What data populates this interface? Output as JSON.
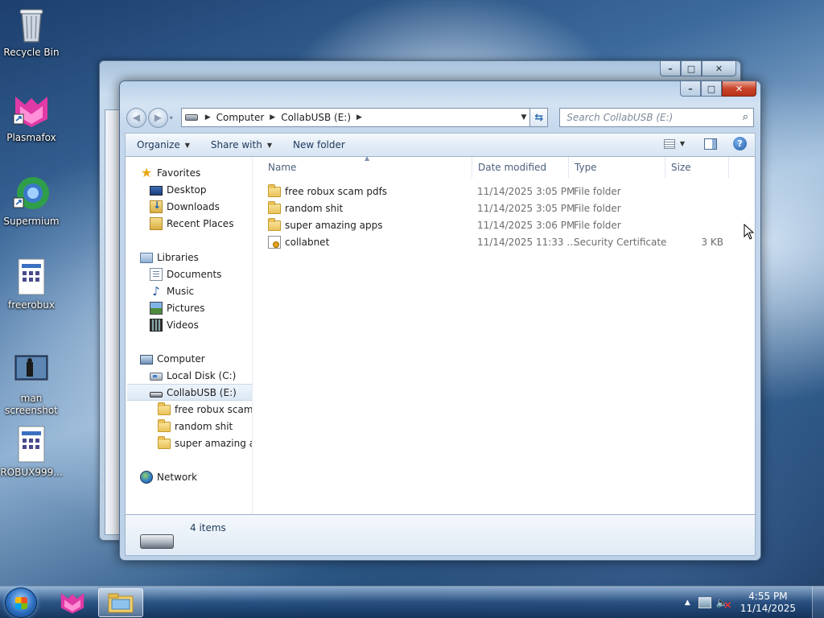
{
  "desktop": {
    "icons": [
      {
        "label": "Recycle Bin",
        "icon": "recycle-bin-icon"
      },
      {
        "label": "Plasmafox",
        "icon": "plasmafox-icon"
      },
      {
        "label": "Supermium",
        "icon": "supermium-icon"
      },
      {
        "label": "freerobux",
        "icon": "executable-file-icon"
      },
      {
        "label": "man screenshot",
        "icon": "image-file-icon"
      },
      {
        "label": "ROBUX999...",
        "icon": "executable-file-icon"
      }
    ]
  },
  "explorer": {
    "address": {
      "crumbs": [
        "Computer",
        "CollabUSB (E:)"
      ]
    },
    "search": {
      "placeholder": "Search CollabUSB (E:)"
    },
    "toolbar": {
      "organize": "Organize",
      "share_with": "Share with",
      "new_folder": "New folder"
    },
    "nav": {
      "favorites": "Favorites",
      "desktop": "Desktop",
      "downloads": "Downloads",
      "recent_places": "Recent Places",
      "libraries": "Libraries",
      "documents": "Documents",
      "music": "Music",
      "pictures": "Pictures",
      "videos": "Videos",
      "computer": "Computer",
      "local_disk": "Local Disk (C:)",
      "collabusb": "CollabUSB (E:)",
      "sub1": "free robux scam pdfs",
      "sub2": "random shit",
      "sub3": "super amazing apps",
      "network": "Network"
    },
    "columns": {
      "name": "Name",
      "date_modified": "Date modified",
      "type": "Type",
      "size": "Size"
    },
    "files": [
      {
        "name": "free robux scam pdfs",
        "date": "11/14/2025 3:05 PM",
        "type": "File folder",
        "size": "",
        "icon": "folder-icon"
      },
      {
        "name": "random shit",
        "date": "11/14/2025 3:05 PM",
        "type": "File folder",
        "size": "",
        "icon": "folder-icon"
      },
      {
        "name": "super amazing apps",
        "date": "11/14/2025 3:06 PM",
        "type": "File folder",
        "size": "",
        "icon": "folder-icon"
      },
      {
        "name": "collabnet",
        "date": "11/14/2025 11:33 ...",
        "type": "Security Certificate",
        "size": "3 KB",
        "icon": "certificate-icon"
      }
    ],
    "status": {
      "item_count": "4 items"
    }
  },
  "taskbar": {
    "clock_time": "4:55 PM",
    "clock_date": "11/14/2025"
  }
}
